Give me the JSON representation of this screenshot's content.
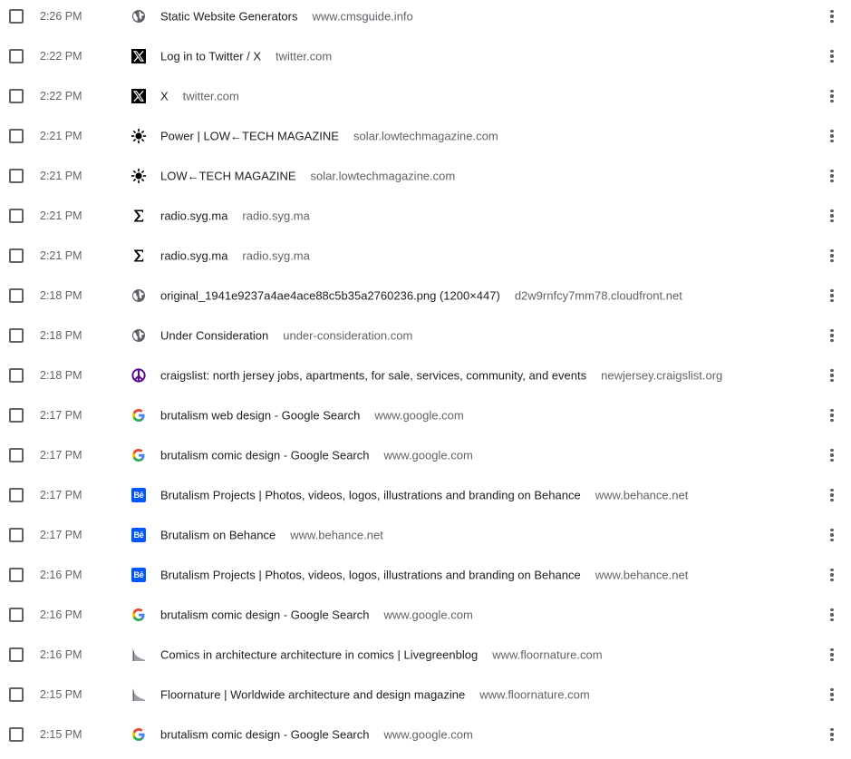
{
  "history": {
    "items": [
      {
        "time": "2:26 PM",
        "icon": "globe-icon",
        "title": "Static Website Generators",
        "domain": "www.cmsguide.info"
      },
      {
        "time": "2:22 PM",
        "icon": "x-logo-icon",
        "title": "Log in to Twitter / X",
        "domain": "twitter.com"
      },
      {
        "time": "2:22 PM",
        "icon": "x-logo-icon",
        "title": "X",
        "domain": "twitter.com"
      },
      {
        "time": "2:21 PM",
        "icon": "sun-icon",
        "title": "Power | LOW←TECH MAGAZINE",
        "domain": "solar.lowtechmagazine.com"
      },
      {
        "time": "2:21 PM",
        "icon": "sun-icon",
        "title": "LOW←TECH MAGAZINE",
        "domain": "solar.lowtechmagazine.com"
      },
      {
        "time": "2:21 PM",
        "icon": "sigma-icon",
        "title": "radio.syg.ma",
        "domain": "radio.syg.ma"
      },
      {
        "time": "2:21 PM",
        "icon": "sigma-icon",
        "title": "radio.syg.ma",
        "domain": "radio.syg.ma"
      },
      {
        "time": "2:18 PM",
        "icon": "globe-icon",
        "title": "original_1941e9237a4ae4ace88c5b35a2760236.png (1200×447)",
        "domain": "d2w9rnfcy7mm78.cloudfront.net"
      },
      {
        "time": "2:18 PM",
        "icon": "globe-icon",
        "title": "Under Consideration",
        "domain": "under-consideration.com"
      },
      {
        "time": "2:18 PM",
        "icon": "peace-icon",
        "title": "craigslist: north jersey jobs, apartments, for sale, services, community, and events",
        "domain": "newjersey.craigslist.org"
      },
      {
        "time": "2:17 PM",
        "icon": "google-icon",
        "title": "brutalism web design - Google Search",
        "domain": "www.google.com"
      },
      {
        "time": "2:17 PM",
        "icon": "google-icon",
        "title": "brutalism comic design - Google Search",
        "domain": "www.google.com"
      },
      {
        "time": "2:17 PM",
        "icon": "behance-icon",
        "title": "Brutalism Projects | Photos, videos, logos, illustrations and branding on Behance",
        "domain": "www.behance.net"
      },
      {
        "time": "2:17 PM",
        "icon": "behance-icon",
        "title": "Brutalism on Behance",
        "domain": "www.behance.net"
      },
      {
        "time": "2:16 PM",
        "icon": "behance-icon",
        "title": "Brutalism Projects | Photos, videos, logos, illustrations and branding on Behance",
        "domain": "www.behance.net"
      },
      {
        "time": "2:16 PM",
        "icon": "google-icon",
        "title": "brutalism comic design - Google Search",
        "domain": "www.google.com"
      },
      {
        "time": "2:16 PM",
        "icon": "floornature-icon",
        "title": "Comics in architecture architecture in comics | Livegreenblog",
        "domain": "www.floornature.com"
      },
      {
        "time": "2:15 PM",
        "icon": "floornature-icon",
        "title": "Floornature | Worldwide architecture and design magazine",
        "domain": "www.floornature.com"
      },
      {
        "time": "2:15 PM",
        "icon": "google-icon",
        "title": "brutalism comic design - Google Search",
        "domain": "www.google.com"
      }
    ],
    "behance_glyph": "Bē"
  },
  "colors": {
    "title_text": "#202124",
    "secondary_text": "#5f6368",
    "behance_blue": "#0057ff",
    "peace_purple": "#5b0a91"
  }
}
